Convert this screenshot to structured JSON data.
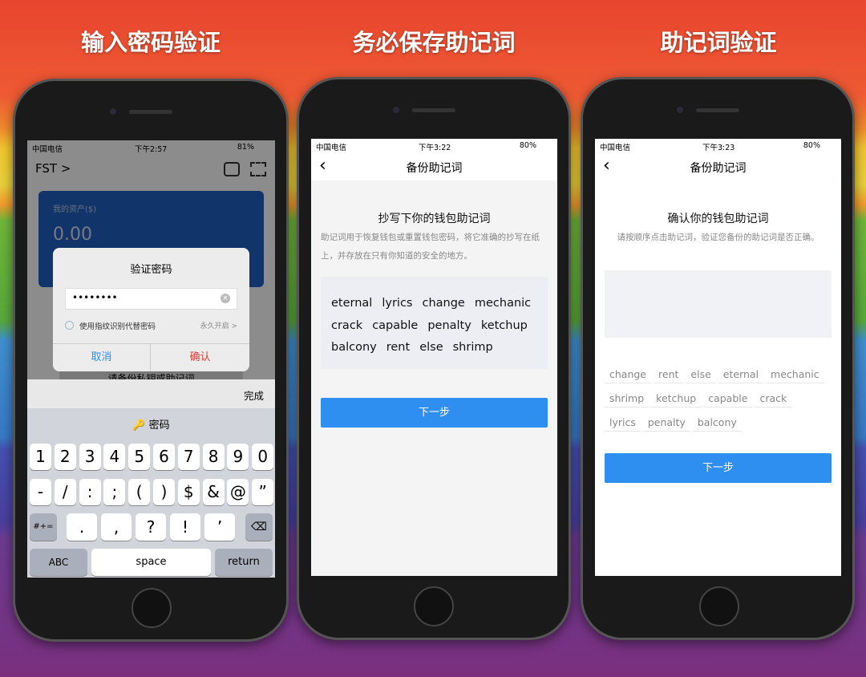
{
  "captions": [
    "输入密码验证",
    "务必保存助记词",
    "助记词验证"
  ],
  "phone1": {
    "status": {
      "carrier": "中国电信",
      "time": "下午2:57",
      "battery": "81%"
    },
    "header": {
      "wallet": "FST >"
    },
    "card": {
      "label": "我的资产($)",
      "amount": "0.00"
    },
    "behind_text": "请备份私钥或助记词",
    "dialog": {
      "title": "验证密码",
      "password": "••••••••",
      "fingerprint_label": "使用指纹识别代替密码",
      "enable_label": "永久开启 >",
      "cancel": "取消",
      "confirm": "确认"
    },
    "keyboard": {
      "done": "完成",
      "suggestion": "密码",
      "row1": [
        "1",
        "2",
        "3",
        "4",
        "5",
        "6",
        "7",
        "8",
        "9",
        "0"
      ],
      "row2": [
        "-",
        "/",
        ":",
        ";",
        "(",
        ")",
        "$",
        "&",
        "@",
        "”"
      ],
      "row3": [
        ".",
        ",",
        "?",
        "!",
        "’"
      ],
      "symbols": "#+=",
      "abc": "ABC",
      "space": "space",
      "return": "return"
    }
  },
  "phone2": {
    "status": {
      "carrier": "中国电信",
      "time": "下午3:22",
      "battery": "80%"
    },
    "nav_title": "备份助记词",
    "heading": "抄写下你的钱包助记词",
    "desc": "助记词用于恢复钱包或重置钱包密码，将它准确的抄写在纸上，并存放在只有你知道的安全的地方。",
    "words": [
      "eternal",
      "lyrics",
      "change",
      "mechanic",
      "crack",
      "capable",
      "penalty",
      "ketchup",
      "balcony",
      "rent",
      "else",
      "shrimp"
    ],
    "next": "下一步"
  },
  "phone3": {
    "status": {
      "carrier": "中国电信",
      "time": "下午3:23",
      "battery": "80%"
    },
    "nav_title": "备份助记词",
    "heading": "确认你的钱包助记词",
    "desc": "请按顺序点击助记词，验证您备份的助记词是否正确。",
    "words": [
      "change",
      "rent",
      "else",
      "eternal",
      "mechanic",
      "shrimp",
      "ketchup",
      "capable",
      "crack",
      "lyrics",
      "penalty",
      "balcony"
    ],
    "next": "下一步"
  },
  "colors": {
    "accent": "#2f8ff1",
    "confirm": "#e53935",
    "card": "#1f5fc4"
  }
}
